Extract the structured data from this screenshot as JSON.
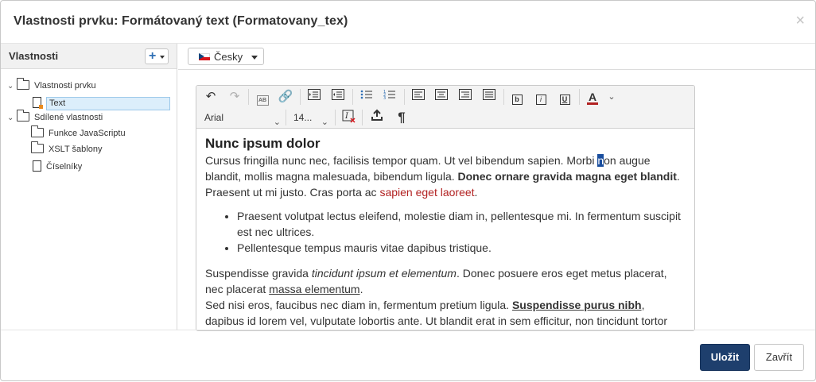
{
  "dialog": {
    "title": "Vlastnosti prvku: Formátovaný text (Formatovany_tex)",
    "close_icon": "close-icon"
  },
  "left_panel": {
    "title": "Vlastnosti",
    "add_button_label": "+",
    "tree": [
      {
        "label": "Vlastnosti prvku",
        "type": "folder",
        "expanded": true
      },
      {
        "label": "Text",
        "type": "document",
        "selected": true
      },
      {
        "label": "Sdílené vlastnosti",
        "type": "folder",
        "expanded": true
      },
      {
        "label": "Funkce JavaScriptu",
        "type": "folder"
      },
      {
        "label": "XSLT šablony",
        "type": "folder"
      },
      {
        "label": "Číselníky",
        "type": "document"
      }
    ]
  },
  "language_selector": {
    "label": "Česky",
    "flag": "czech-flag-icon"
  },
  "toolbar": {
    "font_family": "Arial",
    "font_size": "14...",
    "text_color": "#b22222",
    "icons": [
      "undo-icon",
      "redo-icon",
      "spellcheck-icon",
      "link-icon",
      "indent-icon",
      "outdent-icon",
      "bullet-list-icon",
      "numbered-list-icon",
      "align-left-icon",
      "align-center-icon",
      "align-right-icon",
      "justify-icon",
      "bold-icon",
      "italic-icon",
      "underline-icon",
      "font-color-icon",
      "clear-format-icon",
      "insert-icon",
      "paragraph-icon"
    ]
  },
  "editor": {
    "heading": "Nunc ipsum dolor",
    "p1_a": "Cursus fringilla nunc nec, facilisis tempor quam. Ut vel bibendum sapien. Morbi ",
    "p1_sel": "n",
    "p1_b": "on augue blandit, mollis magna malesuada, bibendum ligula. ",
    "p1_bold": "Donec ornare gravida magna eget blandit",
    "p1_c": ". Praesent ut mi justo. Cras porta ac ",
    "p1_red": "sapien eget laoreet",
    "p1_d": ".",
    "list": [
      "Praesent volutpat lectus eleifend, molestie diam in, pellentesque mi. In fermentum suscipit est nec ultrices.",
      "Pellentesque tempus mauris vitae dapibus tristique."
    ],
    "p2_a": "Suspendisse gravida ",
    "p2_italic": "tincidunt ipsum et elementum",
    "p2_b": ". Donec posuere eros eget metus placerat, nec placerat ",
    "p2_underline": "massa elementum",
    "p2_c": ".",
    "p3_a": "Sed nisi eros, faucibus nec diam in, fermentum pretium ligula. ",
    "p3_bold_underline": "Suspendisse purus nibh",
    "p3_b": ", dapibus id lorem vel, vulputate lobortis ante. Ut blandit erat in sem efficitur, non tincidunt tortor"
  },
  "footer": {
    "save_label": "Uložit",
    "close_label": "Zavřít"
  },
  "colors": {
    "primary": "#1e3f6d",
    "link_red": "#b22222",
    "selection": "#1a4e9e"
  }
}
